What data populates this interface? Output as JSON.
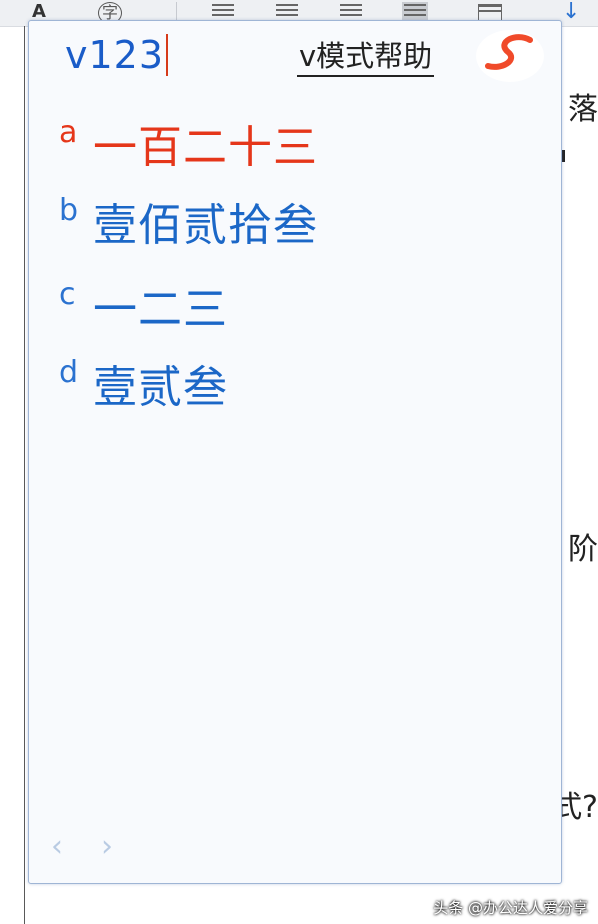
{
  "composition": {
    "text": "v123"
  },
  "help_link": {
    "label": "v模式帮助"
  },
  "candidates": [
    {
      "index": "a",
      "text": "一百二十三"
    },
    {
      "index": "b",
      "text": "壹佰贰拾叁"
    },
    {
      "index": "c",
      "text": "一二三"
    },
    {
      "index": "d",
      "text": "壹贰叁"
    }
  ],
  "nav": {
    "prev": "‹",
    "next": "›"
  },
  "background": {
    "toolbar_glyphs": [
      "A",
      "字"
    ],
    "side_fragments": [
      "落",
      "阶",
      "式?"
    ]
  },
  "watermark": {
    "text": "头条 @办公达人爱分享"
  },
  "colors": {
    "selected": "#e5361a",
    "candidate": "#1b67c7",
    "accent": "#1a5cc8"
  }
}
